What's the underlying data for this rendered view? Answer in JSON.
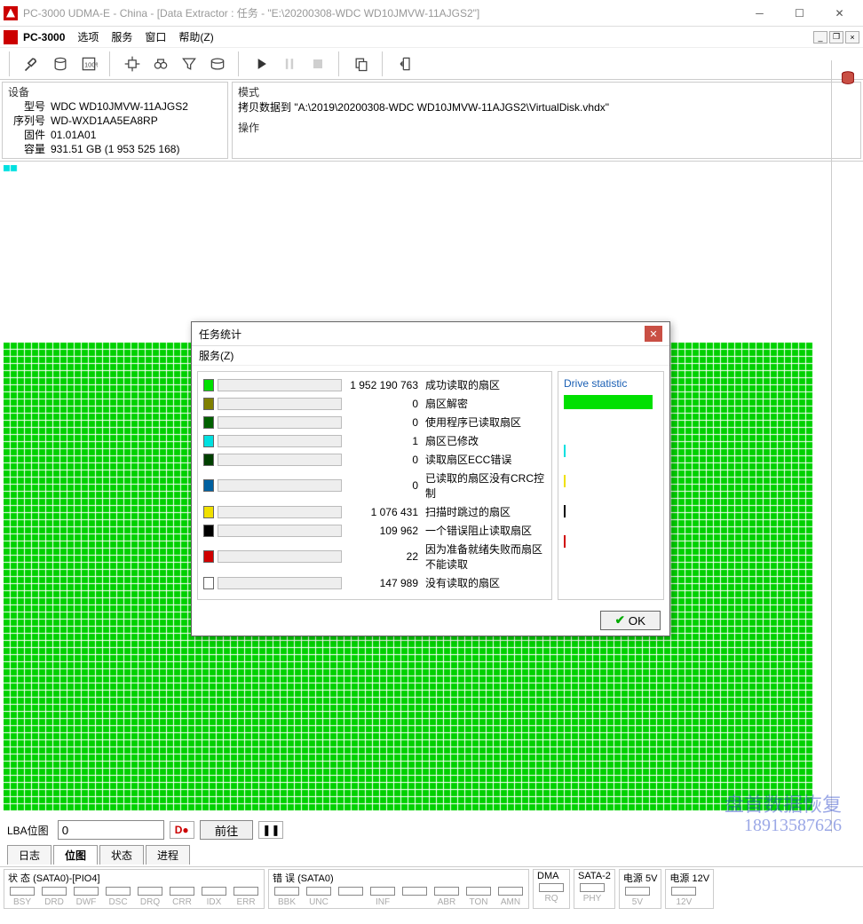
{
  "title": "PC-3000 UDMA-E - China - [Data Extractor : 任务 - \"E:\\20200308-WDC WD10JMVW-11AJGS2\"]",
  "brand": "PC-3000",
  "menu": {
    "options": "选项",
    "services": "服务",
    "window": "窗口",
    "help": "帮助(Z)"
  },
  "device_panel": {
    "title": "设备",
    "model_label": "型号",
    "model": "WDC WD10JMVW-11AJGS2",
    "serial_label": "序列号",
    "serial": "WD-WXD1AA5EA8RP",
    "fw_label": "固件",
    "fw": "01.01A01",
    "cap_label": "容量",
    "cap": "931.51 GB (1 953 525 168)"
  },
  "mode_panel": {
    "mode_label": "模式",
    "mode_value": "拷贝数据到 \"A:\\2019\\20200308-WDC WD10JMVW-11AJGS2\\VirtualDisk.vhdx\"",
    "operation_label": "操作"
  },
  "lba": {
    "label": "LBA位图",
    "value": "0",
    "go": "前往",
    "indicator": "D"
  },
  "tabs": {
    "log": "日志",
    "map": "位图",
    "status": "状态",
    "progress": "进程"
  },
  "dialog": {
    "title": "任务统计",
    "menu": "服务(Z)",
    "drive_stat_title": "Drive statistic",
    "ok": "OK",
    "rows": [
      {
        "color": "#00e000",
        "value": "1 952 190 763",
        "label": "成功读取的扇区"
      },
      {
        "color": "#808000",
        "value": "0",
        "label": "扇区解密"
      },
      {
        "color": "#006000",
        "value": "0",
        "label": "使用程序已读取扇区"
      },
      {
        "color": "#00e0e0",
        "value": "1",
        "label": "扇区已修改"
      },
      {
        "color": "#004000",
        "value": "0",
        "label": "读取扇区ECC错误"
      },
      {
        "color": "#0060a0",
        "value": "0",
        "label": "已读取的扇区没有CRC控制"
      },
      {
        "color": "#f0e000",
        "value": "1 076 431",
        "label": "扫描时跳过的扇区"
      },
      {
        "color": "#000000",
        "value": "109 962",
        "label": "一个错误阻止读取扇区"
      },
      {
        "color": "#d00000",
        "value": "22",
        "label": "因为准备就绪失败而扇区不能读取"
      },
      {
        "color": "#ffffff",
        "value": "147 989",
        "label": "没有读取的扇区"
      }
    ]
  },
  "status_groups": {
    "state": {
      "title": "状 态 (SATA0)-[PIO4]",
      "leds": [
        "BSY",
        "DRD",
        "DWF",
        "DSC",
        "DRQ",
        "CRR",
        "IDX",
        "ERR"
      ]
    },
    "error": {
      "title": "错 误 (SATA0)",
      "leds": [
        "BBK",
        "UNC",
        "",
        "INF",
        "",
        "ABR",
        "TON",
        "AMN"
      ]
    },
    "dma": {
      "title": "DMA",
      "leds": [
        "RQ"
      ]
    },
    "sata2": {
      "title": "SATA-2",
      "leds": [
        "PHY"
      ]
    },
    "pwr5": {
      "title": "电源 5V",
      "leds": [
        "5V"
      ]
    },
    "pwr12": {
      "title": "电源 12V",
      "leds": [
        "12V"
      ]
    }
  },
  "watermark": {
    "line1": "盘首数据恢复",
    "line2": "18913587626"
  }
}
